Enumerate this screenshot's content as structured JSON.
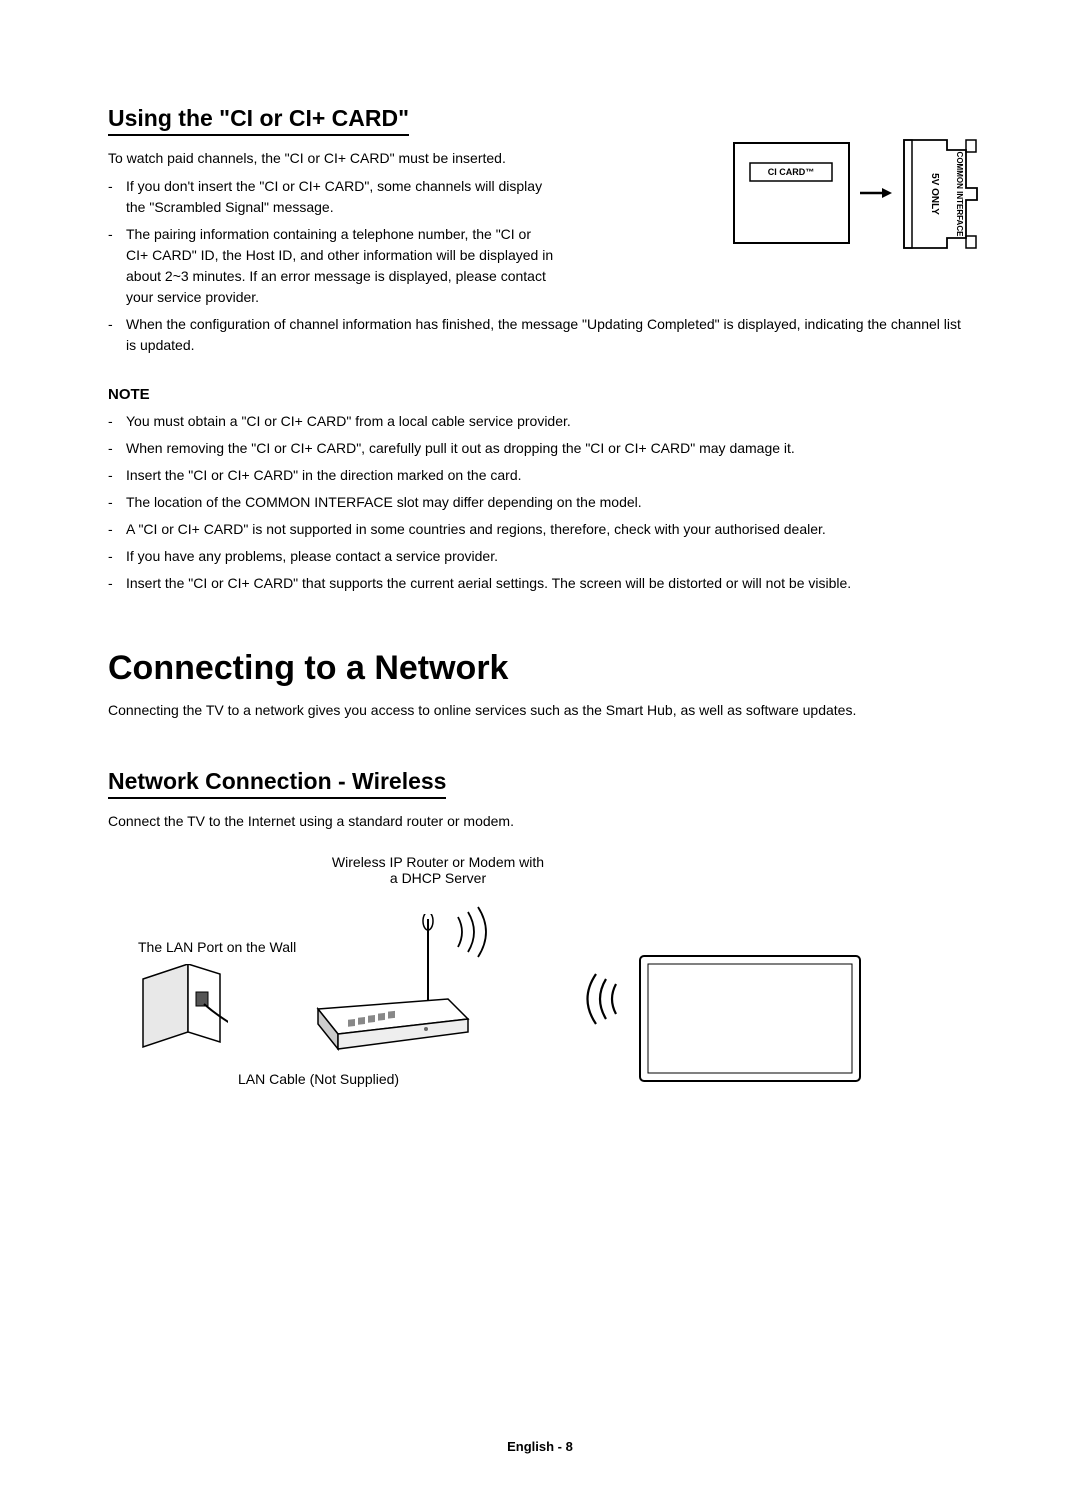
{
  "section1": {
    "title": "Using the \"CI or CI+ CARD\"",
    "intro": "To watch paid channels, the \"CI or CI+ CARD\" must be inserted.",
    "bullets": [
      "If you don't insert the \"CI or CI+ CARD\", some channels will display the \"Scrambled Signal\" message.",
      "The pairing information containing a telephone number, the \"CI or CI+ CARD\" ID, the Host ID, and other information will be displayed in about 2~3 minutes. If an error message is displayed, please contact your service provider.",
      "When the configuration of channel information has finished, the message \"Updating Completed\" is displayed, indicating the channel list is updated."
    ],
    "noteHeading": "NOTE",
    "noteBullets": [
      "You must obtain a \"CI or CI+ CARD\" from a local cable service provider.",
      "When removing the \"CI or CI+ CARD\", carefully pull it out as dropping the \"CI or CI+ CARD\" may damage it.",
      "Insert the \"CI or CI+ CARD\" in the direction marked on the card.",
      "The location of the COMMON INTERFACE slot may differ depending on the model.",
      "A \"CI or CI+ CARD\" is not supported in some countries and regions, therefore, check with your authorised dealer.",
      "If you have any problems, please contact a service provider.",
      "Insert the \"CI or CI+ CARD\" that supports the current aerial settings. The screen will be distorted or will not be visible."
    ]
  },
  "section2": {
    "title": "Connecting to a Network",
    "intro": "Connecting the TV to a network gives you access to online services such as the Smart Hub, as well as software updates."
  },
  "section3": {
    "title": "Network Connection - Wireless",
    "intro": "Connect the TV to the Internet using a standard router or modem.",
    "routerLabel1": "Wireless IP Router or Modem with",
    "routerLabel2": "a DHCP Server",
    "lanLabel": "The LAN Port on the Wall",
    "cableLabel": "LAN Cable (Not Supplied)"
  },
  "diagram": {
    "ciCardLabel": "CI CARD™",
    "fiveVolt": "5V ONLY",
    "commonInterface": "COMMON INTERFACE"
  },
  "footer": "English - 8"
}
